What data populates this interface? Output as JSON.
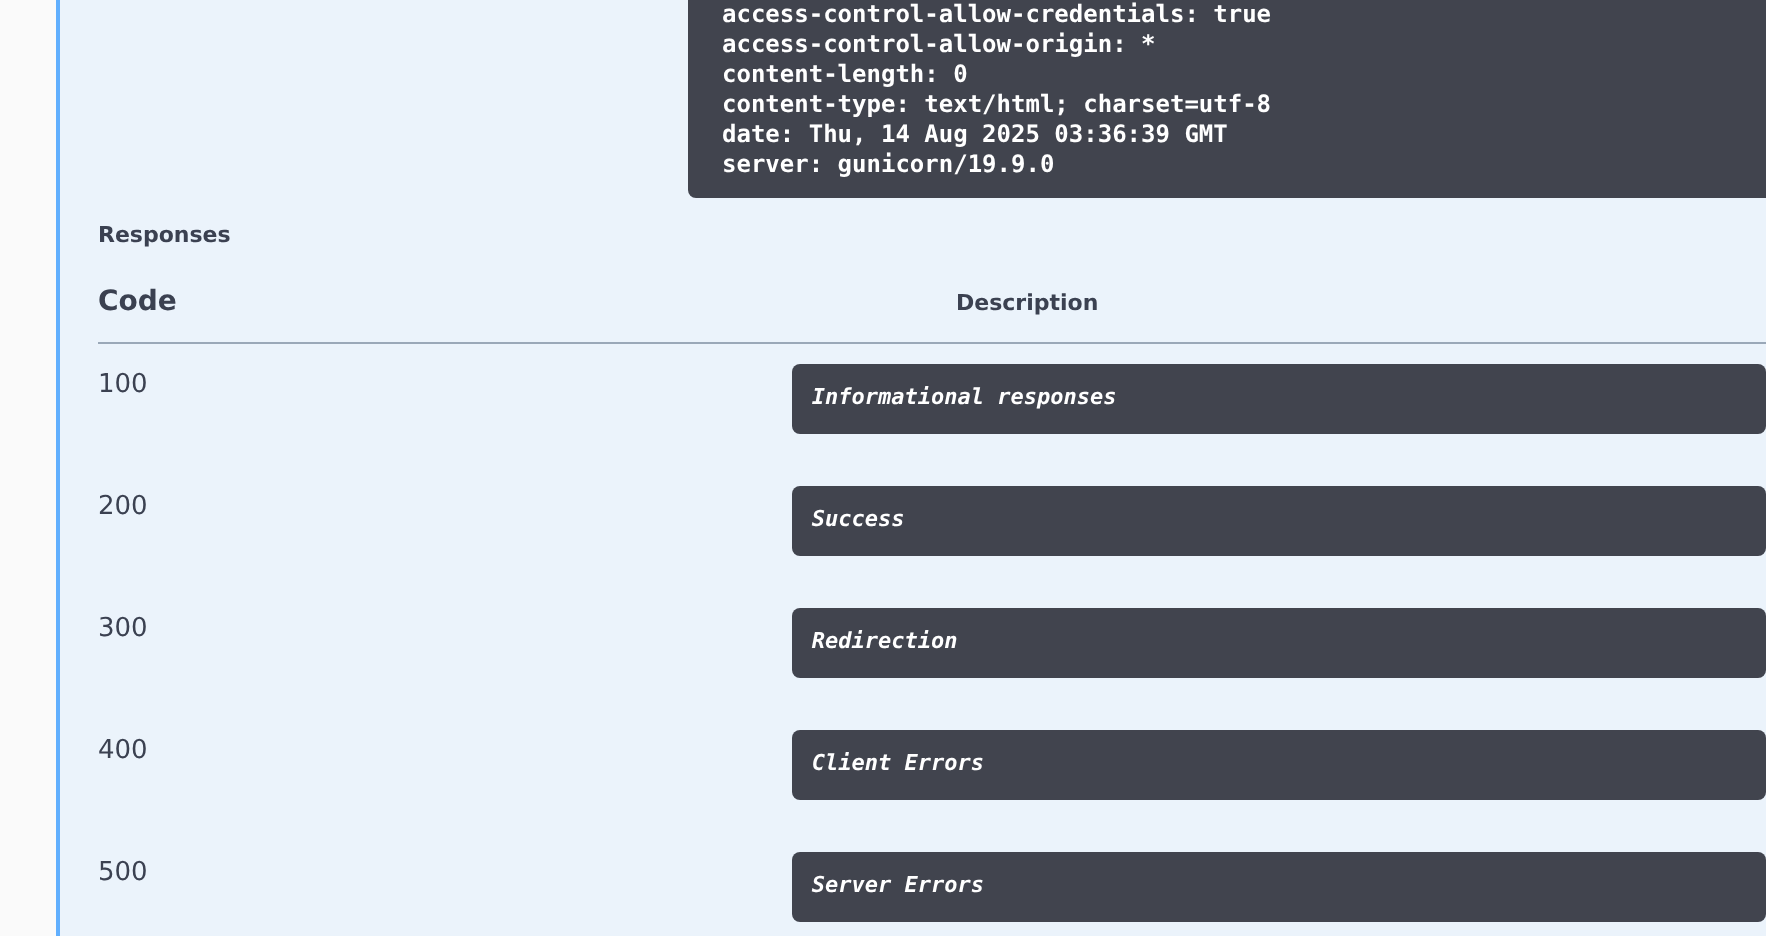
{
  "response_headers": [
    "access-control-allow-credentials: true",
    "access-control-allow-origin: *",
    "content-length: 0",
    "content-type: text/html; charset=utf-8",
    "date: Thu, 14 Aug 2025 03:36:39 GMT",
    "server: gunicorn/19.9.0"
  ],
  "responses": {
    "title": "Responses",
    "columns": [
      "Code",
      "Description"
    ],
    "rows": [
      {
        "code": "100",
        "description": "Informational responses"
      },
      {
        "code": "200",
        "description": "Success"
      },
      {
        "code": "300",
        "description": "Redirection"
      },
      {
        "code": "400",
        "description": "Client Errors"
      },
      {
        "code": "500",
        "description": "Server Errors"
      }
    ]
  }
}
